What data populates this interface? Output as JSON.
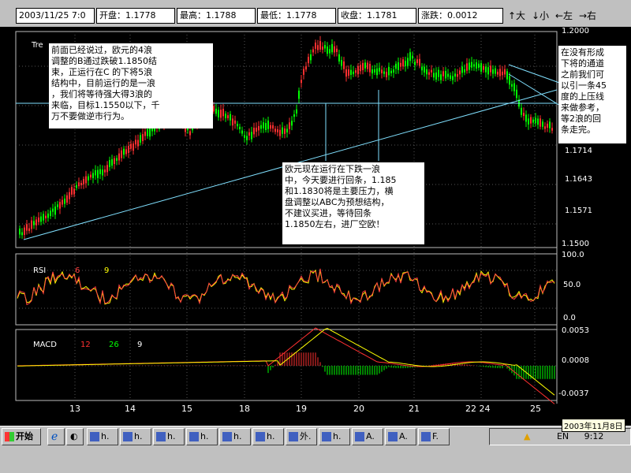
{
  "topbar": {
    "date": "2003/11/25 7:0",
    "open": "开盘：1.1778",
    "high": "最高：1.1788",
    "low": "最低：1.1778",
    "close": "收盘：1.1781",
    "change": "涨跌：0.0012",
    "nav_big": "↑大",
    "nav_small": "↓小",
    "nav_left": "←左",
    "nav_right": "→右"
  },
  "chart": {
    "price_label": "Tre",
    "price_ticks": [
      "1.2000",
      "1.1714",
      "1.1643",
      "1.1571",
      "1.1500"
    ],
    "rsi_label": "RSI",
    "rsi_params": [
      "6",
      "9"
    ],
    "rsi_ticks": [
      "100.0",
      "50.0",
      "0.0"
    ],
    "macd_label": "MACD",
    "macd_params": [
      "12",
      "26",
      "9"
    ],
    "macd_ticks": [
      "0.0053",
      "0.0008",
      "-0.0037"
    ],
    "x_labels": [
      "13",
      "14",
      "15",
      "18",
      "19",
      "20",
      "21",
      "22 24",
      "25"
    ]
  },
  "annotations": {
    "note1": "前面已经说过，欧元的4浪\n调整的B通过跌破1.1850结\n束，正运行在C 的下将5浪\n结构中，目前运行的是一浪\n，我们将等待强大得3浪的\n来临，目标1.1550以下，千\n万不要做逆市行为。",
    "note2": "欧元现在运行在下跌一浪\n中，今天要进行回条，1.185\n和1.1830将是主要压力，横\n盘调整以ABC为预想结构，\n不建议买进，等待回条\n1.1850左右，进厂空欧！",
    "note3": "在没有形成\n下将的通道\n之前我们可\n以引一条45\n度的上压线\n来做参考，\n等2浪的回\n条走完。"
  },
  "taskbar": {
    "start_label": "开始",
    "buttons": [
      "h.",
      "h.",
      "h.",
      "h.",
      "h.",
      "h.",
      "外.",
      "h.",
      "A.",
      "A.",
      "F."
    ],
    "tooltip": "2003年11月8日",
    "clock": "9:12",
    "lang": "EN"
  },
  "colors": {
    "up": "#00ff00",
    "down": "#ff3030",
    "trend": "#80e0ff",
    "rsi_a": "#ffff00",
    "rsi_b": "#ff4040",
    "macd_dif": "#ff3030",
    "macd_dea": "#ffff00"
  }
}
